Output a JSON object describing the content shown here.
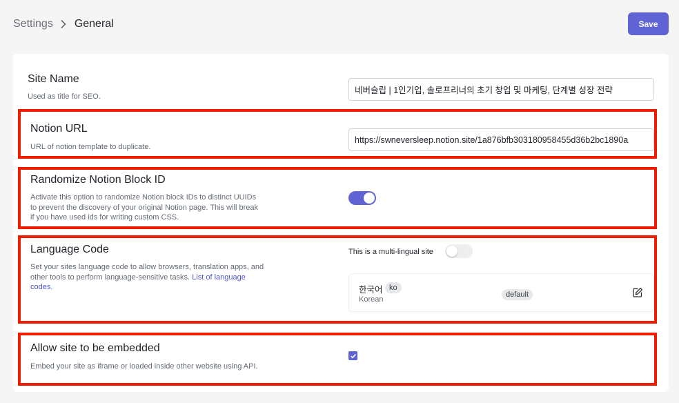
{
  "breadcrumb": {
    "root": "Settings",
    "current": "General"
  },
  "toolbar": {
    "save_label": "Save"
  },
  "sections": {
    "site_name": {
      "title": "Site Name",
      "description": "Used as title for SEO.",
      "value": "네버슬립 | 1인기업, 솔로프리너의 초기 창업 및 마케팅, 단계별 성장 전략"
    },
    "notion_url": {
      "title": "Notion URL",
      "description": "URL of notion template to duplicate.",
      "value": "https://swneversleep.notion.site/1a876bfb303180958455d36b2bc1890a"
    },
    "randomize": {
      "title": "Randomize Notion Block ID",
      "description_lines": [
        "Activate this option to randomize Notion block IDs to distinct UUIDs",
        "to prevent the discovery of your original Notion page. This will break",
        "if you have used ids for writing custom CSS."
      ],
      "enabled": true
    },
    "language": {
      "title": "Language Code",
      "description_lines": [
        "Set your sites language code to allow browsers, translation apps, and",
        "other tools to perform language-sensitive tasks."
      ],
      "link_part1": "List of language",
      "link_part2": "codes.",
      "multilingual_label": "This is a multi-lingual site",
      "multilingual_enabled": false,
      "entry": {
        "name": "한국어",
        "code": "ko",
        "sub": "Korean",
        "badge": "default"
      }
    },
    "embed": {
      "title": "Allow site to be embedded",
      "description": "Embed your site as iframe or loaded inside other website using API.",
      "checked": true
    }
  },
  "colors": {
    "accent": "#5f63d3",
    "highlight": "#f11d00",
    "link": "#4f56cf"
  },
  "icons": [
    "chevron-right-icon",
    "edit-icon",
    "check-icon"
  ]
}
